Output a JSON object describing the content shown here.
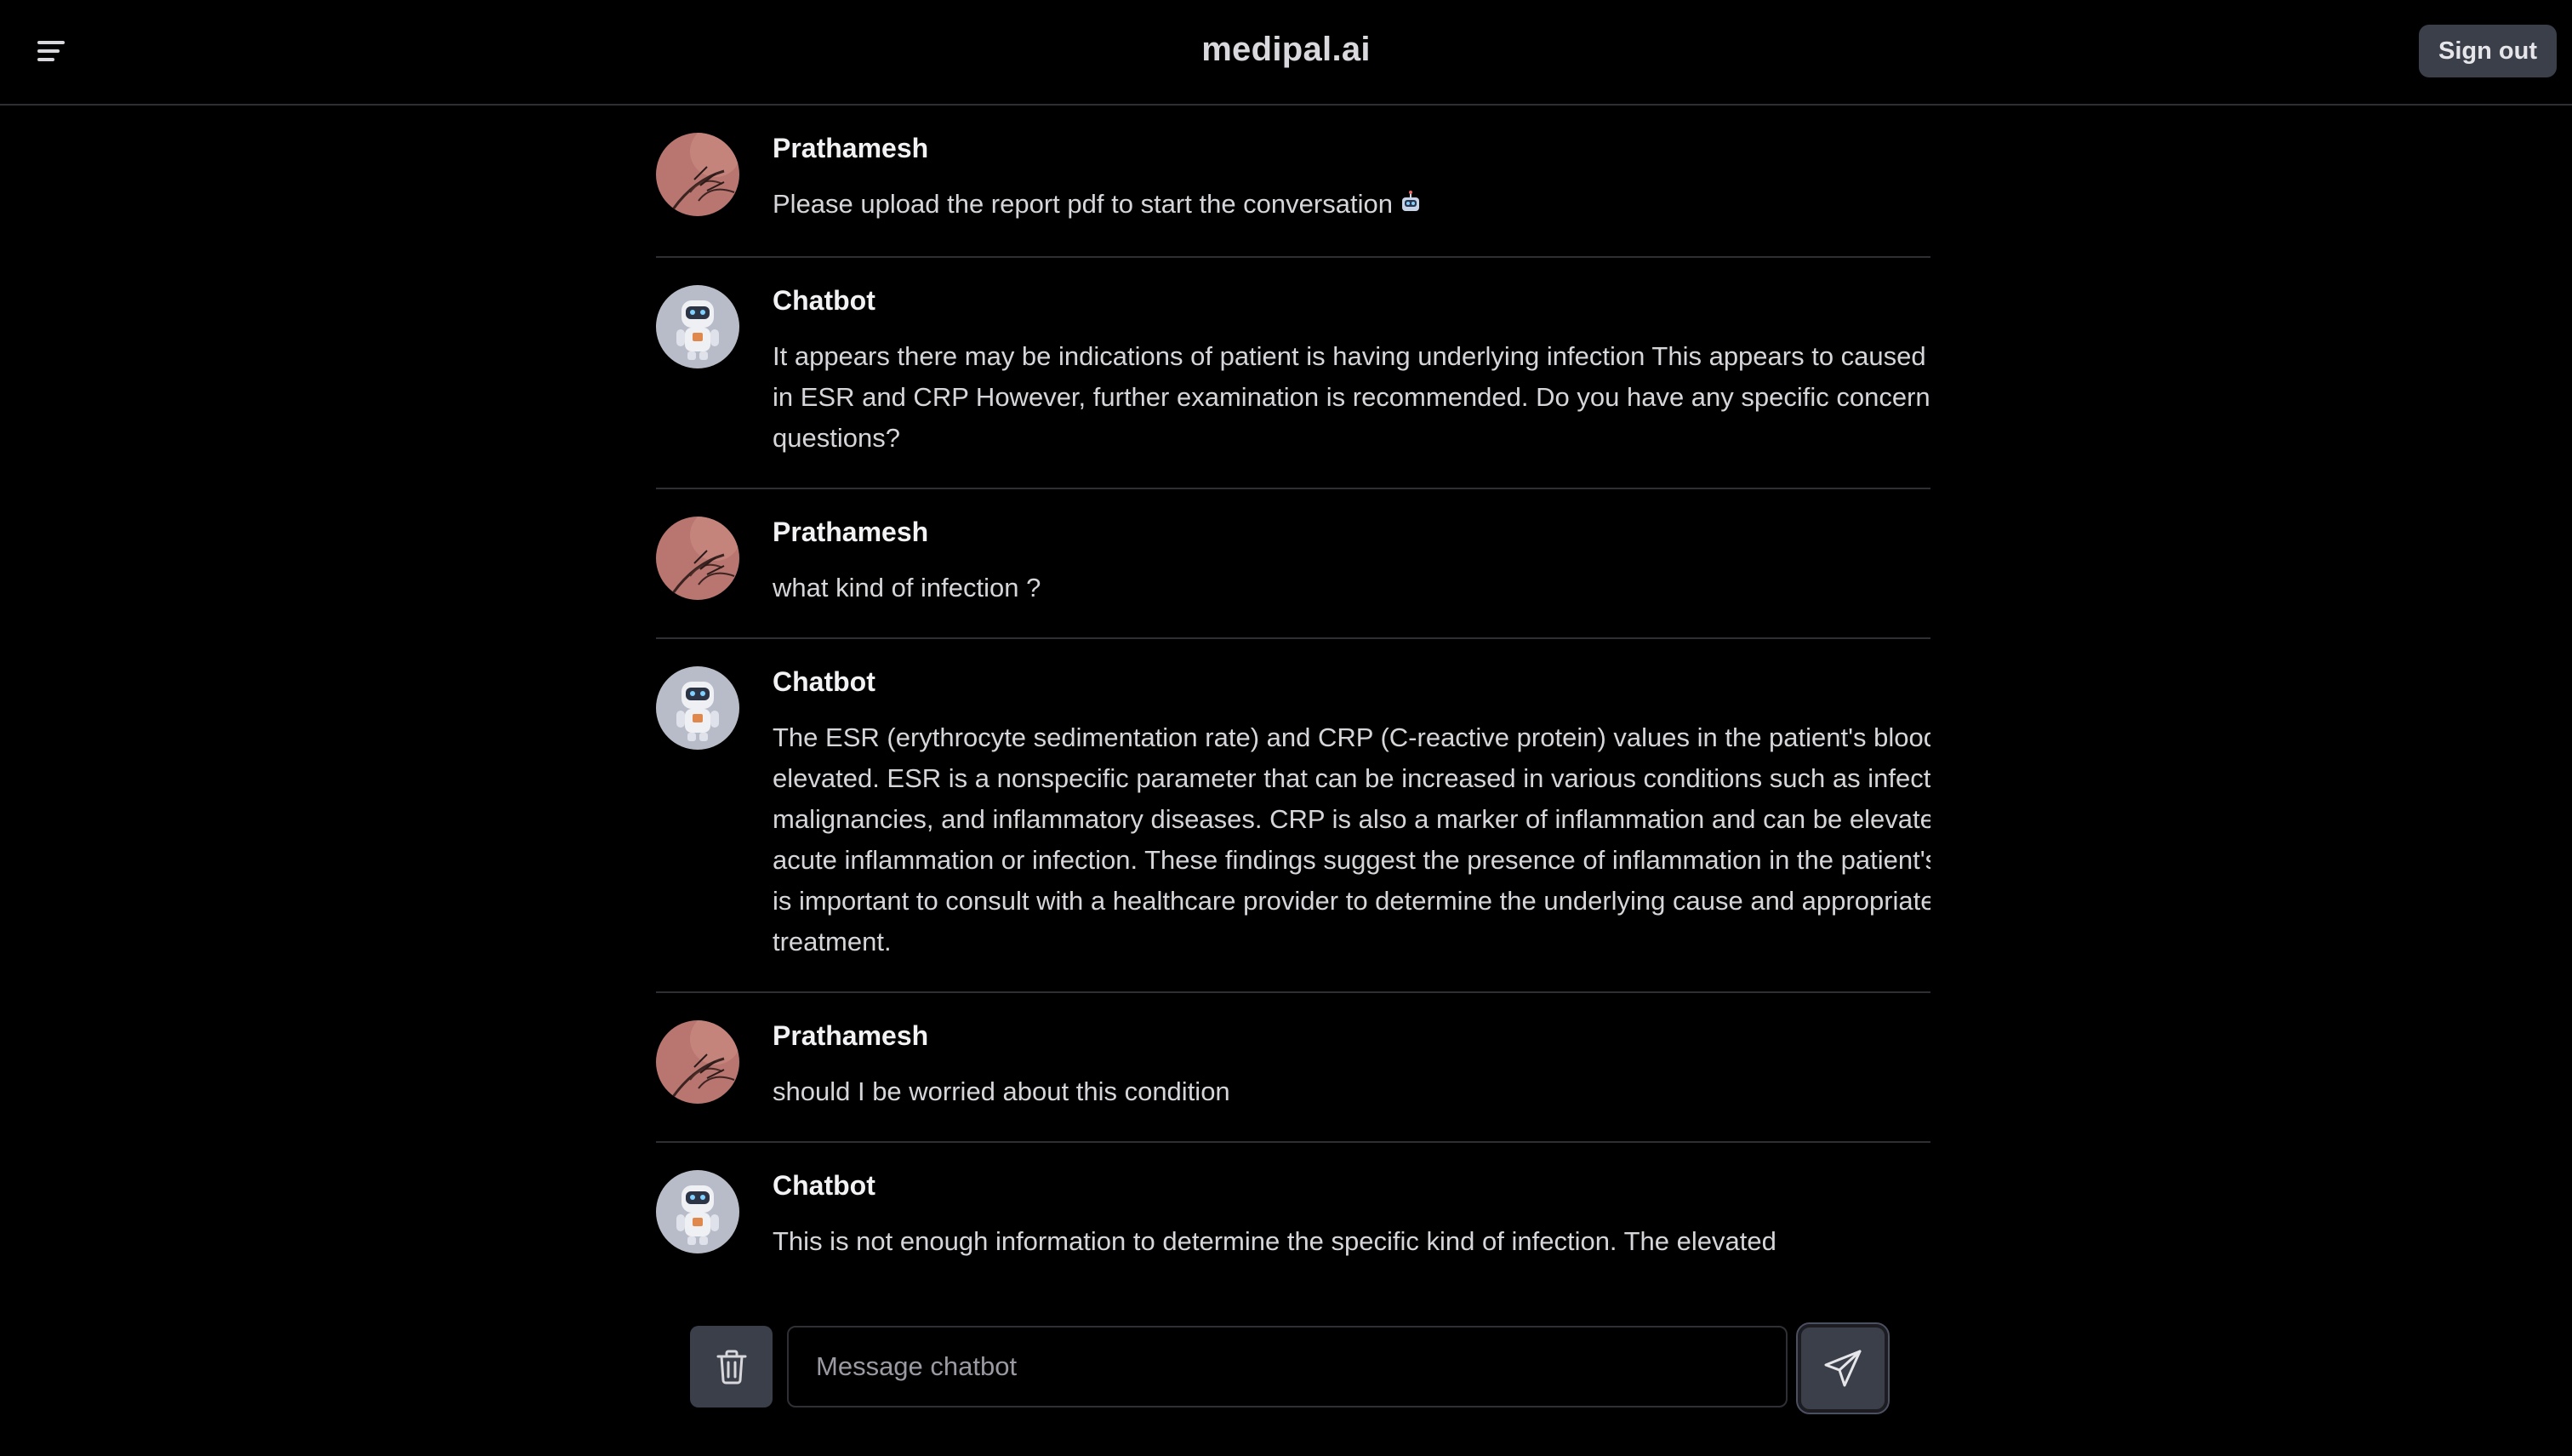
{
  "header": {
    "title": "medipal.ai",
    "signout_label": "Sign out"
  },
  "messages": [
    {
      "sender": "Prathamesh",
      "role": "user",
      "text": "Please upload the report pdf to start the conversation"
    },
    {
      "sender": "Chatbot",
      "role": "bot",
      "text": "It appears there may be indications of patient is having underlying infection This appears to caused by Rise in ESR and CRP However, further examination is recommended. Do you have any specific concerns or questions?"
    },
    {
      "sender": "Prathamesh",
      "role": "user",
      "text": "what kind of infection ?"
    },
    {
      "sender": "Chatbot",
      "role": "bot",
      "text": "The ESR (erythrocyte sedimentation rate) and CRP (C-reactive protein) values in the patient's blood test are elevated. ESR is a nonspecific parameter that can be increased in various conditions such as infections, malignancies, and inflammatory diseases. CRP is also a marker of inflammation and can be elevated in acute inflammation or infection. These findings suggest the presence of inflammation in the patient's body. It is important to consult with a healthcare provider to determine the underlying cause and appropriate treatment."
    },
    {
      "sender": "Prathamesh",
      "role": "user",
      "text": "should I be worried about this condition"
    },
    {
      "sender": "Chatbot",
      "role": "bot",
      "text": "This is not enough information to determine the specific kind of infection. The elevated"
    }
  ],
  "composer": {
    "placeholder": "Message chatbot",
    "value": ""
  },
  "icons": {
    "menu": "menu-icon",
    "trash": "trash-icon",
    "send": "send-icon",
    "robot_emoji": "robot-emoji-icon"
  },
  "colors": {
    "background": "#000000",
    "button": "#3a3f4a",
    "divider": "#2e2e33"
  }
}
